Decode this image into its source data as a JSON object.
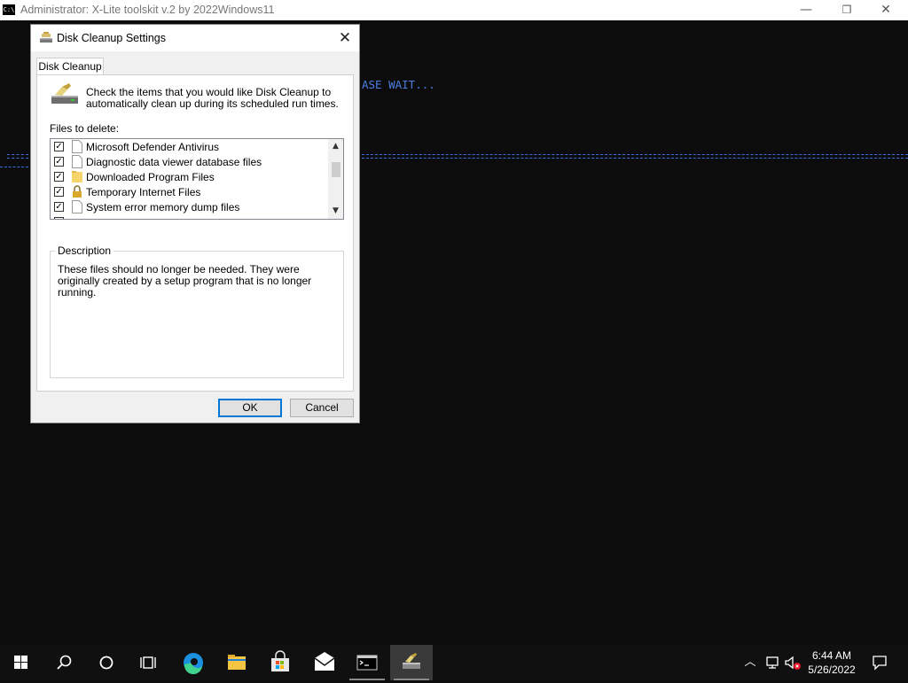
{
  "console": {
    "icon_text": "C:\\",
    "title": "Administrator:  X-Lite toolskit v.2 by 2022Windows11",
    "wait_text": "ASE WAIT...",
    "minimize": "—",
    "restore": "❐",
    "close": "✕"
  },
  "dialog": {
    "title": "Disk Cleanup Settings",
    "close": "✕",
    "tab": "Disk Cleanup",
    "intro": "Check the items that you would like Disk Cleanup to automatically clean up during its scheduled run times.",
    "files_label": "Files to delete:",
    "files": [
      {
        "label": "Microsoft Defender Antivirus",
        "checked": true,
        "icon": "document-icon"
      },
      {
        "label": "Diagnostic data viewer database files",
        "checked": true,
        "icon": "document-icon"
      },
      {
        "label": "Downloaded Program Files",
        "checked": true,
        "icon": "folder-icon"
      },
      {
        "label": "Temporary Internet Files",
        "checked": true,
        "icon": "lock-icon"
      },
      {
        "label": "System error memory dump files",
        "checked": true,
        "icon": "document-icon"
      }
    ],
    "check_mark": "✓",
    "scroll_up": "▲",
    "scroll_down": "▼",
    "description_legend": "Description",
    "description": "These files should no longer be needed. They were originally created by a setup program that is no longer running.",
    "ok": "OK",
    "cancel": "Cancel"
  },
  "taskbar": {
    "items": [
      "start",
      "search",
      "cortana",
      "task-view",
      "edge",
      "file-explorer",
      "store",
      "mail",
      "console",
      "disk-cleanup"
    ],
    "show_hidden": "︿",
    "time": "6:44 AM",
    "date": "5/26/2022"
  },
  "colors": {
    "console_bg": "#0c0c0c",
    "console_text": "#4a7fe0",
    "accent": "#0078d7",
    "taskbar": "#101010"
  }
}
